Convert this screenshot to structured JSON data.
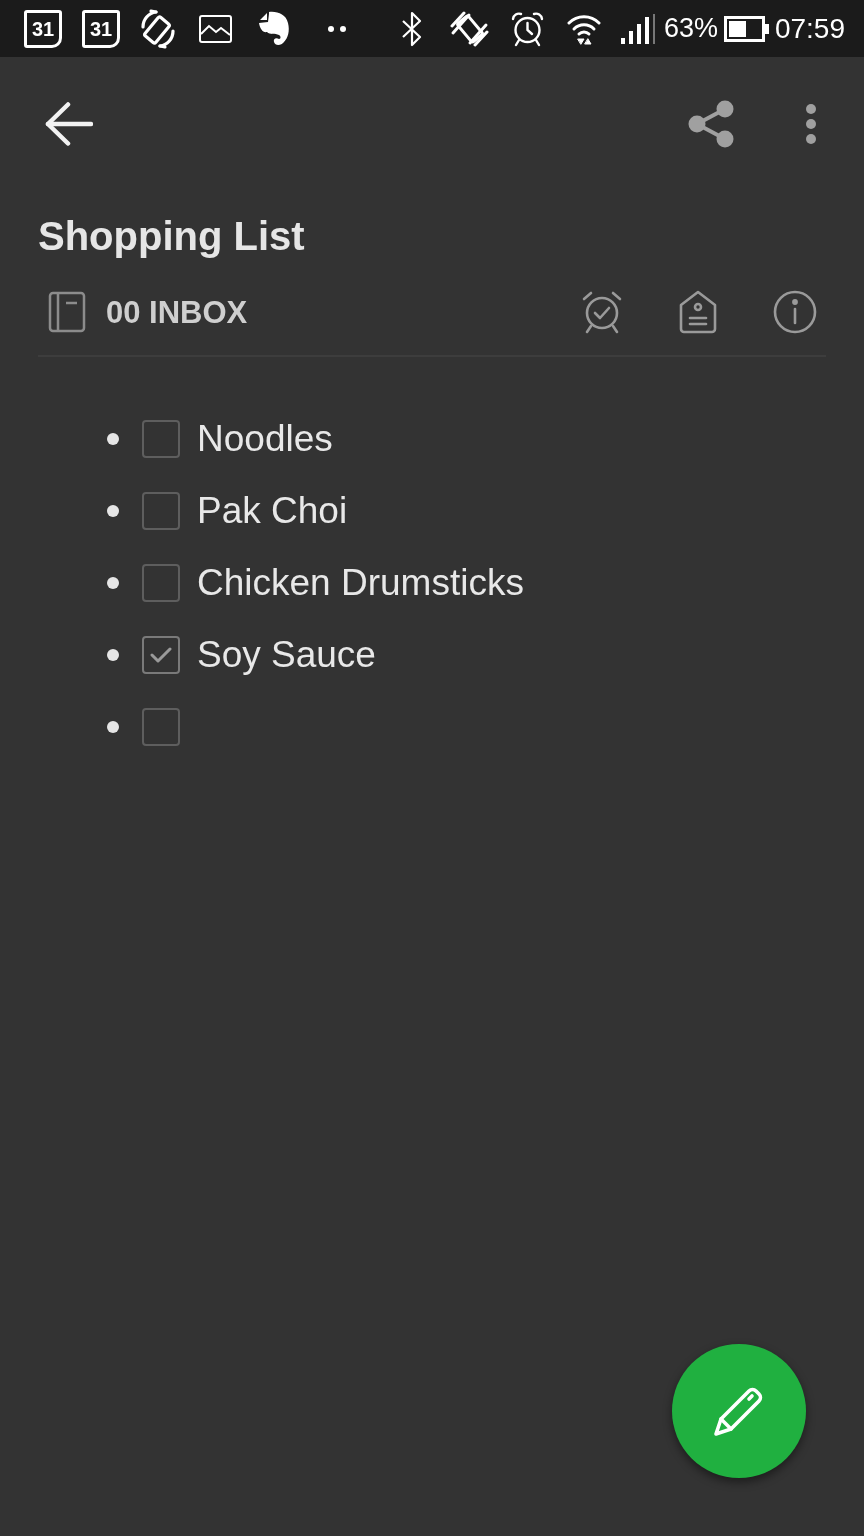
{
  "status_bar": {
    "calendar_dates": [
      "31",
      "31"
    ],
    "battery_percent": "63%",
    "time": "07:59"
  },
  "note": {
    "title": "Shopping List",
    "notebook": "00 INBOX",
    "items": [
      {
        "text": "Noodles",
        "checked": false
      },
      {
        "text": "Pak Choi",
        "checked": false
      },
      {
        "text": "Chicken Drumsticks",
        "checked": false
      },
      {
        "text": "Soy Sauce",
        "checked": true
      },
      {
        "checked": false
      }
    ]
  }
}
